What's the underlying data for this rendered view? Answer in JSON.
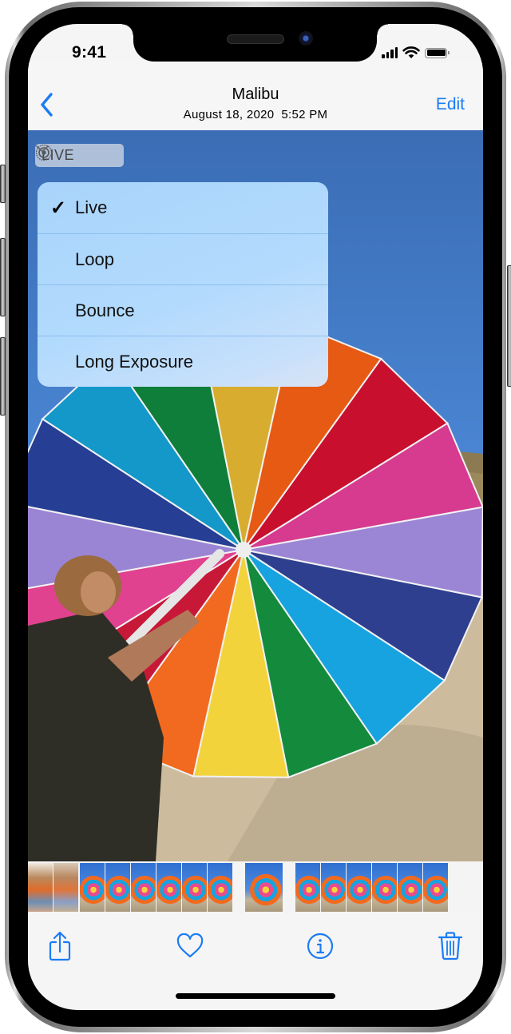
{
  "status_bar": {
    "time": "9:41",
    "signal_bars": 4,
    "battery_level": 1.0,
    "icons": [
      "cellular-signal-icon",
      "wifi-icon",
      "battery-icon"
    ]
  },
  "nav_bar": {
    "back_icon": "chevron-left-icon",
    "title": "Malibu",
    "subtitle": "August 18, 2020  5:52 PM",
    "edit_label": "Edit",
    "accent_color": "#1a7cf4"
  },
  "live_badge": {
    "icon": "live-photo-icon",
    "label": "LIVE",
    "chevron": "chevron-down-icon"
  },
  "effects_menu": {
    "items": [
      {
        "label": "Live",
        "checked": true,
        "check_glyph": "✓"
      },
      {
        "label": "Loop",
        "checked": false,
        "check_glyph": ""
      },
      {
        "label": "Bounce",
        "checked": false,
        "check_glyph": ""
      },
      {
        "label": "Long Exposure",
        "checked": false,
        "check_glyph": ""
      }
    ]
  },
  "photo": {
    "description": "Woman holding a rainbow beach umbrella on sand under blue sky"
  },
  "filmstrip": {
    "thumbnails": [
      {
        "kind": "portrait"
      },
      {
        "kind": "portrait"
      },
      {
        "kind": "umbrella"
      },
      {
        "kind": "umbrella"
      },
      {
        "kind": "umbrella"
      },
      {
        "kind": "umbrella"
      },
      {
        "kind": "umbrella"
      },
      {
        "kind": "umbrella"
      },
      {
        "kind": "umbrella",
        "selected": true
      },
      {
        "kind": "umbrella"
      },
      {
        "kind": "umbrella"
      },
      {
        "kind": "umbrella"
      },
      {
        "kind": "umbrella"
      },
      {
        "kind": "umbrella"
      },
      {
        "kind": "umbrella"
      }
    ]
  },
  "toolbar": {
    "buttons": [
      {
        "name": "share",
        "icon": "share-icon"
      },
      {
        "name": "favorite",
        "icon": "heart-icon"
      },
      {
        "name": "info",
        "icon": "info-icon"
      },
      {
        "name": "delete",
        "icon": "trash-icon"
      }
    ]
  }
}
